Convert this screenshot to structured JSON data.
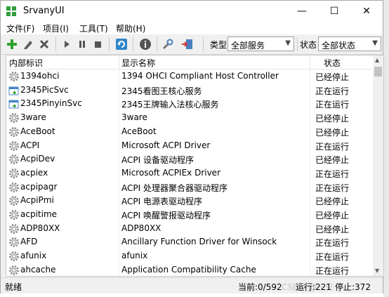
{
  "window": {
    "title": "SrvanyUI",
    "minimize": "—",
    "maximize": "☐",
    "close": "✕"
  },
  "menu": [
    "文件(F)",
    "项目(I)",
    "工具(T)",
    "帮助(H)"
  ],
  "toolbar": {
    "type_label": "类型",
    "type_value": "全部服务",
    "status_label": "状态",
    "status_value": "全部状态"
  },
  "columns": [
    "内部标识",
    "显示名称",
    "状态"
  ],
  "rows": [
    {
      "id": "1394ohci",
      "name": "1394 OHCI Compliant Host Controller",
      "status": "已经停止",
      "icon": "gear-icon"
    },
    {
      "id": "2345PicSvc",
      "name": "2345看图王核心服务",
      "status": "正在运行",
      "icon": "service-app-icon"
    },
    {
      "id": "2345PinyinSvc",
      "name": "2345王牌输入法核心服务",
      "status": "正在运行",
      "icon": "service-app-icon"
    },
    {
      "id": "3ware",
      "name": "3ware",
      "status": "已经停止",
      "icon": "gear-icon"
    },
    {
      "id": "AceBoot",
      "name": "AceBoot",
      "status": "已经停止",
      "icon": "gear-icon"
    },
    {
      "id": "ACPI",
      "name": "Microsoft ACPI Driver",
      "status": "正在运行",
      "icon": "gear-icon"
    },
    {
      "id": "AcpiDev",
      "name": "ACPI 设备驱动程序",
      "status": "已经停止",
      "icon": "gear-icon"
    },
    {
      "id": "acpiex",
      "name": "Microsoft ACPIEx Driver",
      "status": "正在运行",
      "icon": "gear-icon"
    },
    {
      "id": "acpipagr",
      "name": "ACPI 处理器聚合器驱动程序",
      "status": "正在运行",
      "icon": "gear-icon"
    },
    {
      "id": "AcpiPmi",
      "name": "ACPI 电源表驱动程序",
      "status": "已经停止",
      "icon": "gear-icon"
    },
    {
      "id": "acpitime",
      "name": "ACPI 唤醒警报驱动程序",
      "status": "已经停止",
      "icon": "gear-icon"
    },
    {
      "id": "ADP80XX",
      "name": "ADP80XX",
      "status": "已经停止",
      "icon": "gear-icon"
    },
    {
      "id": "AFD",
      "name": "Ancillary Function Driver for Winsock",
      "status": "正在运行",
      "icon": "gear-icon"
    },
    {
      "id": "afunix",
      "name": "afunix",
      "status": "正在运行",
      "icon": "gear-icon"
    },
    {
      "id": "ahcache",
      "name": "Application Compatibility Cache",
      "status": "正在运行",
      "icon": "gear-icon"
    }
  ],
  "status": {
    "left": "就绪",
    "current": "当前:0/592",
    "running": "运行:221",
    "stopped": "停止:372",
    "watermark": "CSDN @一只 "
  },
  "colors": {
    "add_green": "#2fa12f",
    "delete_red": "#d33a3a",
    "app_green": "#2f9d3d"
  }
}
